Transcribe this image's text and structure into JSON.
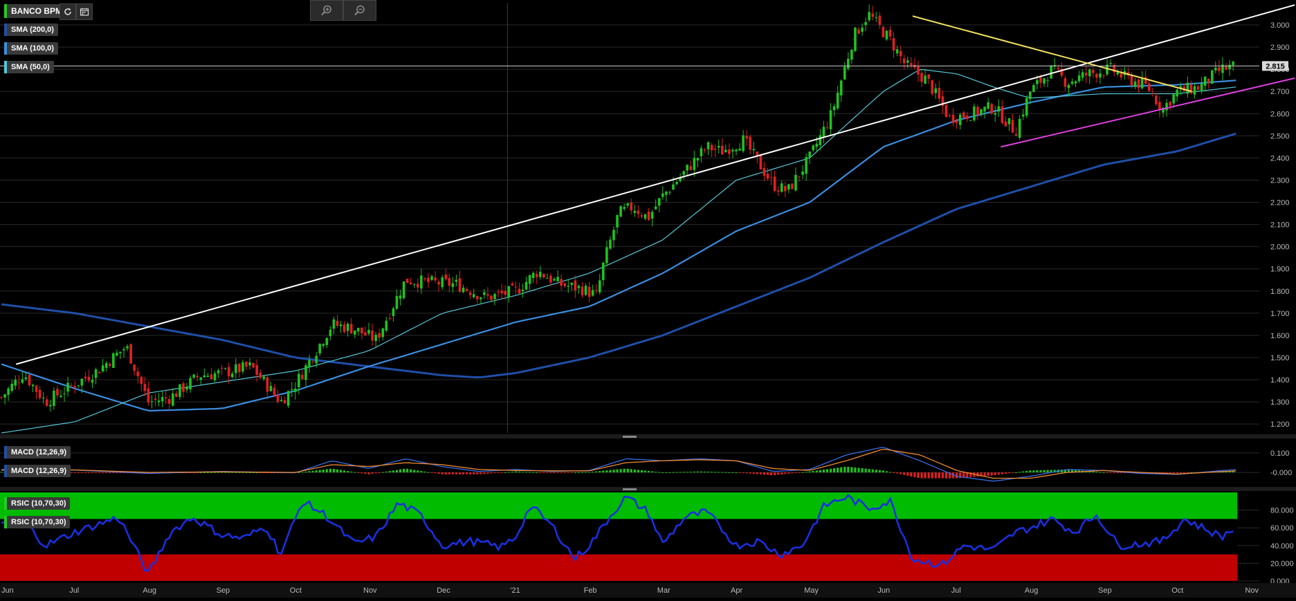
{
  "header": {
    "symbol": "BANCO BPM",
    "symbol_color": "#22cc22",
    "icons": [
      "refresh-icon",
      "calendar-icon",
      "zoom-in-icon",
      "zoom-out-icon"
    ]
  },
  "indicators": {
    "price": [
      {
        "label": "SMA (200,0)",
        "color": "#1f4fa8"
      },
      {
        "label": "SMA (100,0)",
        "color": "#3a8ee0"
      },
      {
        "label": "SMA (50,0)",
        "color": "#55c8d8"
      }
    ],
    "macd": [
      {
        "label": "MACD (12,26,9)",
        "color": "#1f4fa8"
      },
      {
        "label": "MACD (12,26,9)",
        "color": "#1f4fa8"
      }
    ],
    "rsi": [
      {
        "label": "RSIC (10,70,30)",
        "color": "#22cc22"
      },
      {
        "label": "RSIC (10,70,30)",
        "color": "#22cc22"
      }
    ]
  },
  "chart_data": [
    {
      "type": "candlestick",
      "title": "BANCO BPM",
      "x_ticks": [
        "Jun",
        "Jul",
        "Aug",
        "Sep",
        "Oct",
        "Nov",
        "Dec",
        "'21",
        "Feb",
        "Mar",
        "Apr",
        "May",
        "Jun",
        "Jul",
        "Aug",
        "Sep",
        "Oct",
        "Nov"
      ],
      "y_ticks": [
        "1.200",
        "1.300",
        "1.400",
        "1.500",
        "1.600",
        "1.700",
        "1.800",
        "1.900",
        "2.000",
        "2.100",
        "2.200",
        "2.300",
        "2.400",
        "2.500",
        "2.600",
        "2.700",
        "2.800",
        "2.900",
        "3.000"
      ],
      "ylim": [
        1.16,
        3.1
      ],
      "last_price": "2.815",
      "last_price_value": 2.815,
      "up_color": "#1fc21f",
      "down_color": "#e02020",
      "close_anchors": [
        [
          0,
          1.32
        ],
        [
          0.3,
          1.43
        ],
        [
          0.6,
          1.3
        ],
        [
          1.0,
          1.38
        ],
        [
          1.3,
          1.44
        ],
        [
          1.7,
          1.55
        ],
        [
          2.0,
          1.3
        ],
        [
          2.3,
          1.32
        ],
        [
          2.7,
          1.42
        ],
        [
          3.0,
          1.43
        ],
        [
          3.4,
          1.46
        ],
        [
          3.5,
          1.42
        ],
        [
          3.8,
          1.3
        ],
        [
          4.0,
          1.38
        ],
        [
          4.5,
          1.65
        ],
        [
          4.8,
          1.63
        ],
        [
          5.1,
          1.58
        ],
        [
          5.5,
          1.85
        ],
        [
          5.8,
          1.84
        ],
        [
          6.2,
          1.83
        ],
        [
          6.6,
          1.77
        ],
        [
          7.0,
          1.8
        ],
        [
          7.3,
          1.89
        ],
        [
          7.6,
          1.83
        ],
        [
          7.9,
          1.81
        ],
        [
          8.1,
          1.78
        ],
        [
          8.2,
          1.93
        ],
        [
          8.4,
          2.15
        ],
        [
          8.6,
          2.18
        ],
        [
          8.8,
          2.13
        ],
        [
          9.0,
          2.23
        ],
        [
          9.2,
          2.3
        ],
        [
          9.6,
          2.45
        ],
        [
          9.8,
          2.43
        ],
        [
          10.1,
          2.48
        ],
        [
          10.5,
          2.28
        ],
        [
          10.7,
          2.25
        ],
        [
          11.0,
          2.4
        ],
        [
          11.3,
          2.6
        ],
        [
          11.6,
          2.95
        ],
        [
          11.8,
          3.05
        ],
        [
          12.1,
          2.93
        ],
        [
          12.3,
          2.82
        ],
        [
          12.6,
          2.75
        ],
        [
          12.9,
          2.58
        ],
        [
          13.2,
          2.6
        ],
        [
          13.5,
          2.63
        ],
        [
          13.8,
          2.52
        ],
        [
          14.0,
          2.7
        ],
        [
          14.3,
          2.8
        ],
        [
          14.5,
          2.74
        ],
        [
          14.8,
          2.78
        ],
        [
          15.1,
          2.8
        ],
        [
          15.3,
          2.76
        ],
        [
          15.6,
          2.72
        ],
        [
          15.8,
          2.62
        ],
        [
          16.0,
          2.7
        ],
        [
          16.3,
          2.72
        ],
        [
          16.6,
          2.8
        ],
        [
          16.8,
          2.815
        ]
      ],
      "trendlines": [
        {
          "name": "support-uptrend",
          "color": "#ffffff",
          "from": [
            0.2,
            1.47
          ],
          "to": [
            17.6,
            3.09
          ]
        },
        {
          "name": "downtrend",
          "color": "#f0e060",
          "from": [
            12.4,
            3.04
          ],
          "to": [
            16.2,
            2.7
          ]
        },
        {
          "name": "support-rising",
          "color": "#e040e0",
          "from": [
            13.6,
            2.45
          ],
          "to": [
            17.6,
            2.76
          ]
        }
      ],
      "sma_colors": {
        "sma200": "#1f4fa8",
        "sma100": "#3a8ee0",
        "sma50": "#55c8d8"
      },
      "sma200": [
        [
          0,
          1.74
        ],
        [
          1.0,
          1.7
        ],
        [
          2.0,
          1.64
        ],
        [
          3.0,
          1.58
        ],
        [
          4.0,
          1.5
        ],
        [
          5.0,
          1.46
        ],
        [
          6.0,
          1.42
        ],
        [
          6.5,
          1.41
        ],
        [
          7.0,
          1.43
        ],
        [
          8.0,
          1.5
        ],
        [
          9.0,
          1.6
        ],
        [
          10.0,
          1.73
        ],
        [
          11.0,
          1.86
        ],
        [
          12.0,
          2.02
        ],
        [
          13.0,
          2.17
        ],
        [
          14.0,
          2.27
        ],
        [
          15.0,
          2.37
        ],
        [
          16.0,
          2.43
        ],
        [
          16.8,
          2.51
        ]
      ],
      "sma100": [
        [
          0,
          1.47
        ],
        [
          1.0,
          1.36
        ],
        [
          1.6,
          1.3
        ],
        [
          2.0,
          1.26
        ],
        [
          3.0,
          1.27
        ],
        [
          4.0,
          1.35
        ],
        [
          5.0,
          1.46
        ],
        [
          6.0,
          1.56
        ],
        [
          7.0,
          1.66
        ],
        [
          8.0,
          1.73
        ],
        [
          9.0,
          1.88
        ],
        [
          10.0,
          2.07
        ],
        [
          11.0,
          2.2
        ],
        [
          12.0,
          2.45
        ],
        [
          13.0,
          2.57
        ],
        [
          14.0,
          2.65
        ],
        [
          15.0,
          2.72
        ],
        [
          16.0,
          2.73
        ],
        [
          16.8,
          2.75
        ]
      ],
      "sma50": [
        [
          0,
          1.16
        ],
        [
          1.0,
          1.21
        ],
        [
          2.0,
          1.34
        ],
        [
          3.0,
          1.39
        ],
        [
          4.0,
          1.44
        ],
        [
          5.0,
          1.53
        ],
        [
          6.0,
          1.7
        ],
        [
          7.0,
          1.78
        ],
        [
          8.0,
          1.88
        ],
        [
          9.0,
          2.03
        ],
        [
          10.0,
          2.3
        ],
        [
          11.0,
          2.4
        ],
        [
          12.0,
          2.7
        ],
        [
          12.5,
          2.8
        ],
        [
          13.0,
          2.78
        ],
        [
          13.5,
          2.72
        ],
        [
          14.0,
          2.67
        ],
        [
          15.0,
          2.69
        ],
        [
          16.0,
          2.69
        ],
        [
          16.8,
          2.72
        ]
      ]
    },
    {
      "type": "macd",
      "y_ticks": [
        "0.100",
        "-0.000"
      ],
      "ylim": [
        -0.06,
        0.16
      ],
      "macd_color": "#3a6ee8",
      "signal_color": "#f08a30",
      "hist_up_color": "#1fc21f",
      "hist_down_color": "#e02020",
      "macd_anchors": [
        [
          0,
          0.015
        ],
        [
          1,
          0.012
        ],
        [
          2,
          -0.005
        ],
        [
          3,
          0.005
        ],
        [
          4,
          -0.002
        ],
        [
          4.5,
          0.06
        ],
        [
          5,
          0.02
        ],
        [
          5.5,
          0.07
        ],
        [
          6,
          0.03
        ],
        [
          6.5,
          0.005
        ],
        [
          7,
          0.015
        ],
        [
          7.5,
          0.005
        ],
        [
          8,
          0.01
        ],
        [
          8.5,
          0.07
        ],
        [
          9,
          0.06
        ],
        [
          9.5,
          0.07
        ],
        [
          10,
          0.06
        ],
        [
          10.5,
          0.005
        ],
        [
          11,
          0.015
        ],
        [
          11.5,
          0.09
        ],
        [
          12,
          0.13
        ],
        [
          12.5,
          0.06
        ],
        [
          13,
          -0.02
        ],
        [
          13.5,
          -0.045
        ],
        [
          14,
          -0.02
        ],
        [
          14.5,
          0.015
        ],
        [
          15,
          0.01
        ],
        [
          15.5,
          -0.005
        ],
        [
          16,
          -0.01
        ],
        [
          16.8,
          0.015
        ]
      ],
      "signal_anchors": [
        [
          0,
          0.012
        ],
        [
          1,
          0.013
        ],
        [
          2,
          0.0
        ],
        [
          3,
          0.003
        ],
        [
          4,
          0.0
        ],
        [
          4.5,
          0.04
        ],
        [
          5,
          0.03
        ],
        [
          5.5,
          0.05
        ],
        [
          6,
          0.04
        ],
        [
          6.5,
          0.015
        ],
        [
          7,
          0.01
        ],
        [
          7.5,
          0.008
        ],
        [
          8,
          0.008
        ],
        [
          8.5,
          0.05
        ],
        [
          9,
          0.06
        ],
        [
          9.5,
          0.065
        ],
        [
          10,
          0.06
        ],
        [
          10.5,
          0.02
        ],
        [
          11,
          0.01
        ],
        [
          11.5,
          0.06
        ],
        [
          12,
          0.12
        ],
        [
          12.5,
          0.09
        ],
        [
          13,
          0.01
        ],
        [
          13.5,
          -0.03
        ],
        [
          14,
          -0.03
        ],
        [
          14.5,
          0.0
        ],
        [
          15,
          0.01
        ],
        [
          15.5,
          0.0
        ],
        [
          16,
          -0.008
        ],
        [
          16.8,
          0.008
        ]
      ]
    },
    {
      "type": "rsi",
      "y_ticks": [
        "80.000",
        "60.000",
        "40.000",
        "20.000",
        "0.000"
      ],
      "ylim": [
        0,
        100
      ],
      "overbought": 70,
      "oversold": 30,
      "overbought_color": "#00bb00",
      "oversold_color": "#c00000",
      "line_color": "#1a2fe0",
      "rsi_anchors": [
        [
          0,
          62
        ],
        [
          0.3,
          68
        ],
        [
          0.6,
          40
        ],
        [
          1.0,
          55
        ],
        [
          1.6,
          72
        ],
        [
          2.0,
          8
        ],
        [
          2.3,
          55
        ],
        [
          2.6,
          72
        ],
        [
          3.0,
          52
        ],
        [
          3.3,
          48
        ],
        [
          3.6,
          62
        ],
        [
          3.8,
          30
        ],
        [
          4.1,
          90
        ],
        [
          4.4,
          75
        ],
        [
          4.8,
          42
        ],
        [
          5.1,
          50
        ],
        [
          5.4,
          88
        ],
        [
          5.7,
          75
        ],
        [
          6.0,
          40
        ],
        [
          6.4,
          45
        ],
        [
          6.8,
          38
        ],
        [
          7.0,
          50
        ],
        [
          7.2,
          85
        ],
        [
          7.5,
          62
        ],
        [
          7.8,
          25
        ],
        [
          8.0,
          40
        ],
        [
          8.3,
          75
        ],
        [
          8.5,
          95
        ],
        [
          8.8,
          78
        ],
        [
          9.0,
          42
        ],
        [
          9.3,
          72
        ],
        [
          9.6,
          78
        ],
        [
          10.0,
          40
        ],
        [
          10.3,
          45
        ],
        [
          10.6,
          30
        ],
        [
          10.9,
          40
        ],
        [
          11.2,
          85
        ],
        [
          11.5,
          95
        ],
        [
          11.8,
          82
        ],
        [
          12.1,
          90
        ],
        [
          12.4,
          25
        ],
        [
          12.8,
          18
        ],
        [
          13.1,
          40
        ],
        [
          13.5,
          35
        ],
        [
          13.8,
          55
        ],
        [
          14.0,
          60
        ],
        [
          14.3,
          70
        ],
        [
          14.6,
          55
        ],
        [
          14.9,
          75
        ],
        [
          15.2,
          40
        ],
        [
          15.5,
          42
        ],
        [
          15.8,
          45
        ],
        [
          16.1,
          70
        ],
        [
          16.4,
          58
        ],
        [
          16.6,
          50
        ],
        [
          16.8,
          60
        ]
      ]
    }
  ]
}
